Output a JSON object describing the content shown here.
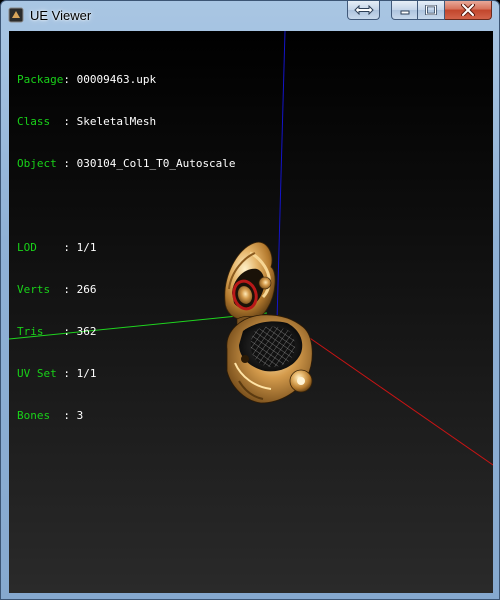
{
  "window": {
    "title": "UE Viewer"
  },
  "info": {
    "package": {
      "label": "Package",
      "sep": ":",
      "value": "00009463.upk"
    },
    "class": {
      "label": "Class  ",
      "sep": ":",
      "value": "SkeletalMesh"
    },
    "object": {
      "label": "Object ",
      "sep": ":",
      "value": "030104_Col1_T0_Autoscale"
    },
    "lod": {
      "label": "LOD    ",
      "sep": ":",
      "value": "1/1"
    },
    "verts": {
      "label": "Verts  ",
      "sep": ":",
      "value": "266"
    },
    "tris": {
      "label": "Tris   ",
      "sep": ":",
      "value": "362"
    },
    "uvset": {
      "label": "UV Set ",
      "sep": ":",
      "value": "1/1"
    },
    "bones": {
      "label": "Bones  ",
      "sep": ":",
      "value": "3"
    }
  },
  "colors": {
    "label_green": "#19d219",
    "axis_x": "#c81414",
    "axis_y": "#1fd41f",
    "axis_z": "#1414c8",
    "mesh_gold": "#d9a55a"
  }
}
